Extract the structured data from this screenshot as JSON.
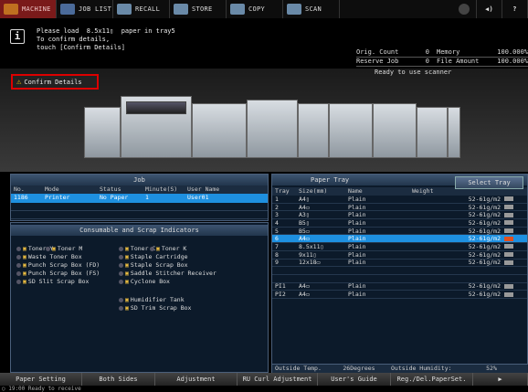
{
  "tabs": [
    {
      "label": "MACHINE",
      "icon": "machine-icon",
      "active": true
    },
    {
      "label": "JOB LIST",
      "icon": "job-list-icon"
    },
    {
      "label": "RECALL",
      "icon": "recall-icon"
    },
    {
      "label": "STORE",
      "icon": "store-icon"
    },
    {
      "label": "COPY",
      "icon": "copy-icon"
    },
    {
      "label": "SCAN",
      "icon": "scan-icon"
    }
  ],
  "header_icons": [
    "status-circle-icon",
    "speaker-icon",
    "help-icon"
  ],
  "help_label": "?",
  "message": {
    "line1": "Please load  8.5x11▯  paper in tray5",
    "line2": "To confirm details,",
    "line3": "touch [Confirm Details]"
  },
  "stats": {
    "orig_count_label": "Orig. Count",
    "orig_count": "0",
    "memory_label": "Memory",
    "memory": "100.000%",
    "reserve_job_label": "Reserve Job",
    "reserve_job": "0",
    "file_amount_label": "File Amount",
    "file_amount": "100.000%"
  },
  "ready_text": "Ready to use scanner",
  "confirm_details": "Confirm Details",
  "job": {
    "title": "Job",
    "columns": [
      "No.",
      "Mode",
      "Status",
      "Minute(S)",
      "User Name"
    ],
    "rows": [
      [
        "1186",
        "Printer",
        "No Paper",
        "1",
        "User01"
      ]
    ]
  },
  "consumables": {
    "title": "Consumable and Scrap Indicators",
    "items": [
      "Toner Y",
      "Toner M",
      "Toner C",
      "Toner K",
      "Waste Toner Box",
      "Staple Cartridge",
      "Punch Scrap Box (FD)",
      "Staple Scrap Box",
      "Punch Scrap Box (FS)",
      "Saddle Stitcher Receiver",
      "SD Slit Scrap Box",
      "Cyclone Box",
      "Humidifier Tank",
      "SD Trim Scrap Box"
    ]
  },
  "tray": {
    "title": "Paper Tray",
    "select_label": "Select Tray",
    "columns": [
      "Tray",
      "Size(mm)",
      "Name",
      "Weight"
    ],
    "rows": [
      [
        "1",
        "A4▯",
        "Plain",
        "52-61g/m2"
      ],
      [
        "2",
        "A4▭",
        "Plain",
        "52-61g/m2"
      ],
      [
        "3",
        "A3▯",
        "Plain",
        "52-61g/m2"
      ],
      [
        "4",
        "B5▯",
        "Plain",
        "52-61g/m2"
      ],
      [
        "5",
        "B5▭",
        "Plain",
        "52-61g/m2"
      ],
      [
        "6",
        "A4▭",
        "Plain",
        "52-61g/m2"
      ],
      [
        "7",
        "8.5x11▯",
        "Plain",
        "52-61g/m2"
      ],
      [
        "8",
        "9x11▯",
        "Plain",
        "52-61g/m2"
      ],
      [
        "9",
        "12x18▭",
        "Plain",
        "52-61g/m2"
      ],
      [
        "",
        "",
        "",
        ""
      ],
      [
        "",
        "",
        "",
        ""
      ],
      [
        "PI1",
        "A4▭",
        "Plain",
        "52-61g/m2"
      ],
      [
        "PI2",
        "A4▭",
        "Plain",
        "52-61g/m2"
      ]
    ],
    "selected_index": 5,
    "temp_label": "Outside Temp.",
    "temp_value": "26Degrees",
    "humidity_label": "Outside Humidity:",
    "humidity_value": "52%"
  },
  "bottom": [
    "Paper Setting",
    "Both Sides",
    "Adjustment",
    "RU Curl Adjustment",
    "User's Guide",
    "Reg./Del.PaperSet."
  ],
  "bottom_arrow": "▶",
  "status": "○ 19:00  Ready to receive"
}
